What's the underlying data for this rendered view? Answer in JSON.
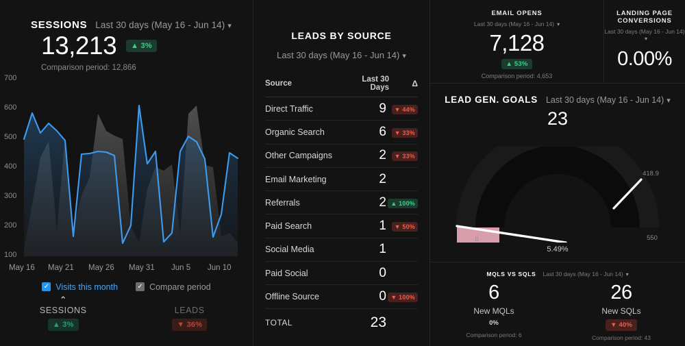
{
  "sessions": {
    "title": "SESSIONS",
    "date_range": "Last 30 days (May 16 - Jun 14)",
    "caret_icon": "chevron-down-icon",
    "value": "13,213",
    "delta": "3%",
    "delta_direction": "up",
    "delta_arrow": "▲",
    "comparison": "Comparison period: 12,866",
    "legend": [
      {
        "label": "Visits this month",
        "color": "#2196f3",
        "checked": true
      },
      {
        "label": "Compare period",
        "color": "#6e6e6e",
        "checked": true
      }
    ],
    "footer": [
      {
        "label": "SESSIONS",
        "delta": "3%",
        "arrow": "▲",
        "direction": "up",
        "chevron": "⌃"
      },
      {
        "label": "LEADS",
        "delta": "36%",
        "arrow": "▼",
        "direction": "down",
        "chevron": ""
      }
    ]
  },
  "chart_data": {
    "type": "line",
    "title": "SESSIONS",
    "xlabel": "",
    "ylabel": "",
    "ylim": [
      100,
      700
    ],
    "yticks": [
      700,
      600,
      500,
      400,
      300,
      200,
      100
    ],
    "xticks": [
      "May 16",
      "May 21",
      "May 26",
      "May 31",
      "Jun 5",
      "Jun 10"
    ],
    "grid": false,
    "legend_position": "bottom",
    "series": [
      {
        "name": "Visits this month",
        "color": "#3d9bf0",
        "type": "line",
        "values": [
          540,
          624,
          560,
          590,
          565,
          535,
          228,
          492,
          495,
          500,
          498,
          488,
          205,
          262,
          648,
          460,
          500,
          210,
          238,
          500,
          548,
          530,
          475,
          225,
          298,
          495,
          478
        ]
      },
      {
        "name": "Compare period",
        "color": "#4a4a4a",
        "type": "area",
        "values": [
          190,
          330,
          480,
          532,
          250,
          545,
          235,
          340,
          400,
          600,
          545,
          530,
          520,
          300,
          250,
          420,
          490,
          480,
          500,
          280,
          600,
          625,
          475,
          470,
          290,
          300,
          270
        ]
      }
    ]
  },
  "leads": {
    "title": "LEADS BY SOURCE",
    "date_range": "Last 30 days (May 16 - Jun 14)",
    "caret_icon": "chevron-down-icon",
    "columns": [
      "Source",
      "Last 30 Days",
      "Δ"
    ],
    "rows": [
      {
        "source": "Direct Traffic",
        "value": "9",
        "delta": "44%",
        "arrow": "▼",
        "direction": "down"
      },
      {
        "source": "Organic Search",
        "value": "6",
        "delta": "33%",
        "arrow": "▼",
        "direction": "down"
      },
      {
        "source": "Other Campaigns",
        "value": "2",
        "delta": "33%",
        "arrow": "▼",
        "direction": "down"
      },
      {
        "source": "Email Marketing",
        "value": "2",
        "delta": "",
        "arrow": "",
        "direction": "none"
      },
      {
        "source": "Referrals",
        "value": "2",
        "delta": "100%",
        "arrow": "▲",
        "direction": "up"
      },
      {
        "source": "Paid Search",
        "value": "1",
        "delta": "50%",
        "arrow": "▼",
        "direction": "down"
      },
      {
        "source": "Social Media",
        "value": "1",
        "delta": "",
        "arrow": "",
        "direction": "none"
      },
      {
        "source": "Paid Social",
        "value": "0",
        "delta": "",
        "arrow": "",
        "direction": "none"
      },
      {
        "source": "Offline Source",
        "value": "0",
        "delta": "100%",
        "arrow": "▼",
        "direction": "down"
      }
    ],
    "total_label": "TOTAL",
    "total_value": "23"
  },
  "email_opens": {
    "title": "EMAIL OPENS",
    "date_range": "Last 30 days (May 16 - Jun 14)",
    "caret_icon": "chevron-down-icon",
    "value": "7,128",
    "delta": "53%",
    "arrow": "▲",
    "direction": "up",
    "comparison": "Comparison period: 4,653"
  },
  "landing_page": {
    "title": "LANDING PAGE CONVERSIONS",
    "date_range": "Last 30 days (May 16 - Jun 14)",
    "caret_icon": "chevron-down-icon",
    "value": "0.00%"
  },
  "lead_gen": {
    "title": "LEAD GEN. GOALS",
    "date_range": "Last 30 days (May 16 - Jun 14)",
    "caret_icon": "chevron-down-icon",
    "value": "23"
  },
  "gauge_chart": {
    "type": "gauge",
    "min_label": "0",
    "max_label": "550",
    "target_label": "418.9",
    "percent_label": "5.49%",
    "needle_color": "#ffffff",
    "progress_color": "#e8a9b8",
    "track_color": "#191919"
  },
  "mqls_sqls": {
    "title": "MQLS VS SQLS",
    "date_range": "Last 30 days (May 16 - Jun 14)",
    "caret_icon": "chevron-down-icon",
    "columns": [
      {
        "value": "6",
        "label": "New MQLs",
        "delta": "0%",
        "arrow": "",
        "direction": "flat",
        "comparison": "Comparison period: 6"
      },
      {
        "value": "26",
        "label": "New SQLs",
        "delta": "40%",
        "arrow": "▼",
        "direction": "down",
        "comparison": "Comparison period: 43"
      }
    ]
  },
  "colors": {
    "accent_blue": "#2196f3",
    "line_blue": "#3d9bf0",
    "up_green": "#3ecf8e",
    "down_red": "#e8604c",
    "panel_bg": "#131313",
    "page_bg": "#0e0e0e"
  }
}
